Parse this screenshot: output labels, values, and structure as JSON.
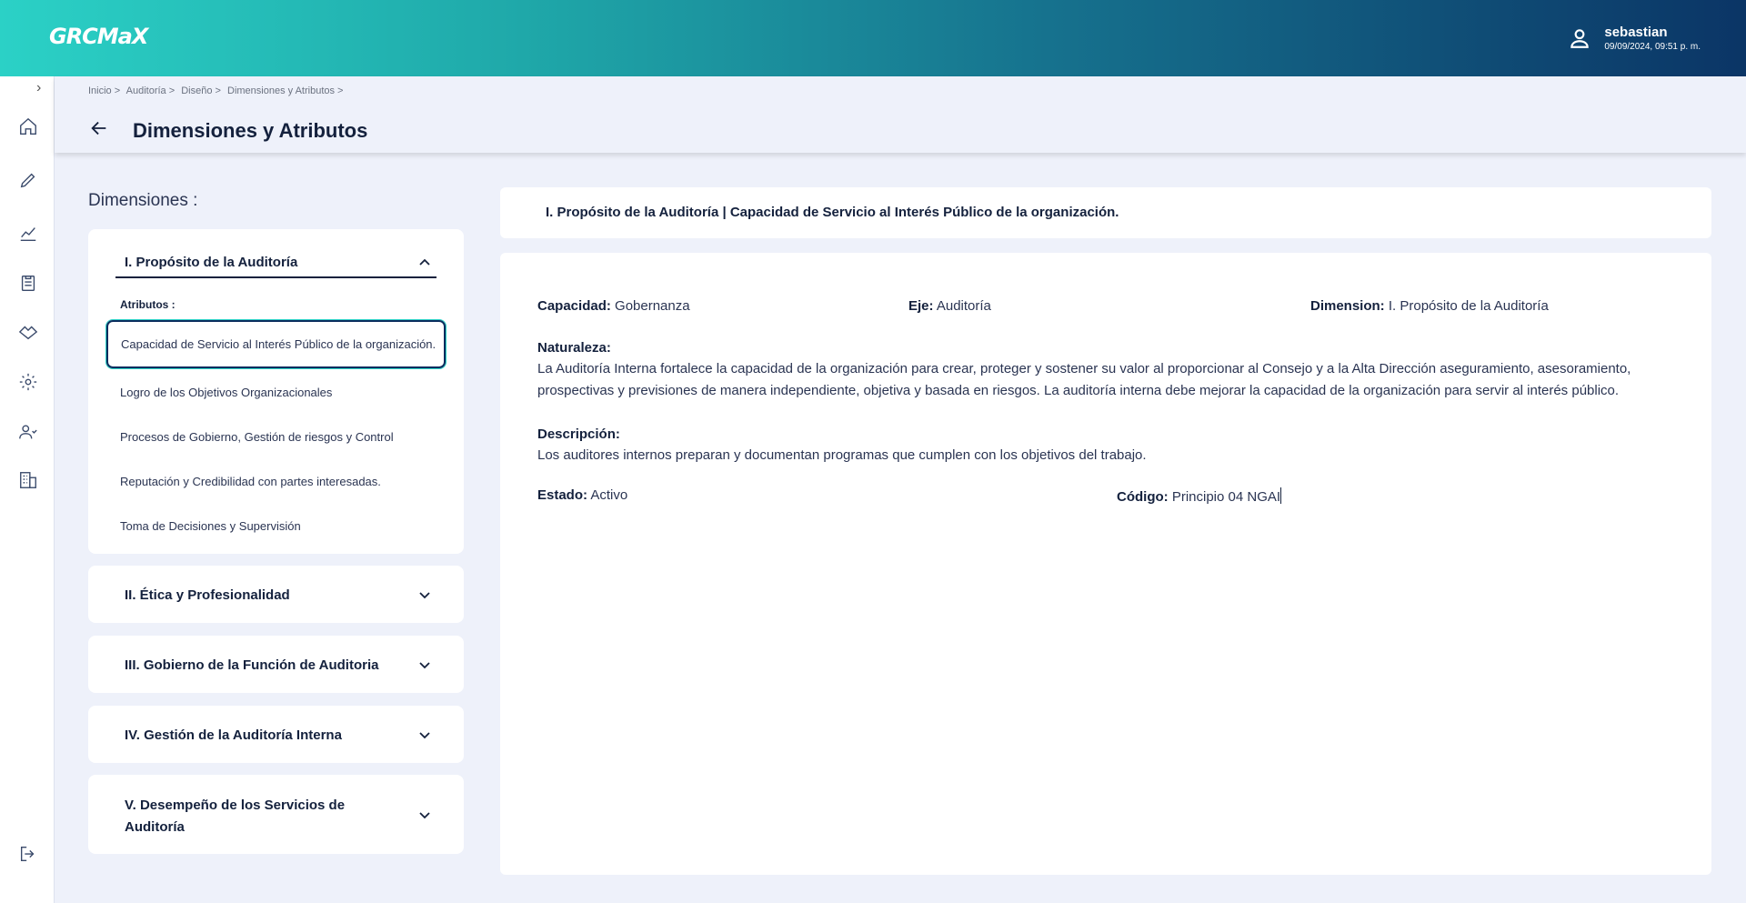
{
  "app": {
    "logo": "GRCMaX"
  },
  "user": {
    "name": "sebastian",
    "datetime": "09/09/2024, 09:51 p. m."
  },
  "breadcrumb": [
    "Inicio >",
    "Auditoría >",
    "Diseño >",
    "Dimensiones y Atributos >"
  ],
  "page": {
    "title": "Dimensiones y Atributos",
    "dimensions_label": "Dimensiones :"
  },
  "dimensions": [
    {
      "label": "I. Propósito de la Auditoría",
      "expanded": true
    },
    {
      "label": "II. Ética y Profesionalidad",
      "expanded": false
    },
    {
      "label": "III. Gobierno de la Función de Auditoria",
      "expanded": false
    },
    {
      "label": "IV. Gestión de la Auditoría Interna",
      "expanded": false
    },
    {
      "label": "V. Desempeño de los Servicios de Auditoría",
      "expanded": false
    }
  ],
  "attributes": {
    "label": "Atributos :",
    "items": [
      "Capacidad de Servicio al Interés Público de la organización.",
      "Logro de los Objetivos Organizacionales",
      "Procesos de Gobierno, Gestión de riesgos y Control",
      "Reputación y Credibilidad con partes interesadas.",
      "Toma de Decisiones y Supervisión"
    ],
    "selected_index": 0
  },
  "detail": {
    "header": "I. Propósito de la Auditoría | Capacidad de Servicio al Interés Público de la organización.",
    "capacidad_label": "Capacidad:",
    "capacidad_value": " Gobernanza",
    "eje_label": "Eje:",
    "eje_value": " Auditoría",
    "dimension_label": "Dimension:",
    "dimension_value": " I. Propósito de la Auditoría",
    "naturaleza_label": "Naturaleza:",
    "naturaleza_text": "La Auditoría Interna fortalece la capacidad de la organización para crear, proteger y sostener su valor al proporcionar al Consejo y a la Alta Dirección aseguramiento, asesoramiento, prospectivas y previsiones de manera independiente, objetiva y basada en riesgos. La auditoría interna debe mejorar la capacidad de la organización para servir al interés público.",
    "descripcion_label": "Descripción:",
    "descripcion_text": "Los auditores internos preparan y documentan programas que cumplen con los objetivos del trabajo.",
    "estado_label": "Estado:",
    "estado_value": " Activo",
    "codigo_label": "Código:",
    "codigo_value": " Principio 04 NGAI"
  },
  "colors": {
    "accent": "#2bd1c6",
    "navy": "#0b3566"
  }
}
